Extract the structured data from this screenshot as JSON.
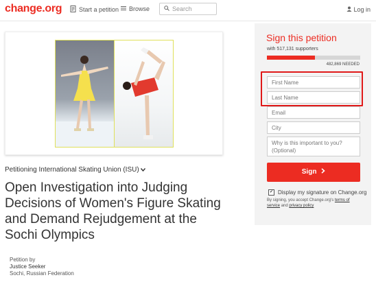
{
  "header": {
    "logo": "change.org",
    "start_petition": "Start a petition",
    "browse": "Browse",
    "search_placeholder": "Search",
    "login": "Log in"
  },
  "petition": {
    "petitioning": "Petitioning International Skating Union (ISU)",
    "title": "Open Investigation into Judging Decisions of Women's Figure Skating and Demand Rejudgement at the Sochi Olympics",
    "petition_by_label": "Petition by",
    "author": "Justice Seeker",
    "location": "Sochi, Russian Federation"
  },
  "sign_panel": {
    "heading": "Sign this petition",
    "supporters": "with 517,131 supporters",
    "progress": 0.516,
    "needed": "482,869 NEEDED",
    "fields": {
      "first_name": "First Name",
      "last_name": "Last Name",
      "email": "Email",
      "city": "City",
      "why": "Why is this important to you? (Optional)"
    },
    "sign_button": "Sign",
    "display_signature": "Display my signature on Change.org",
    "terms_prefix": "By signing, you accept Change.org's",
    "terms_link": "terms of service",
    "terms_and": "and",
    "privacy_link": "privacy policy"
  },
  "colors": {
    "brand": "#ec2c22",
    "highlight": "#e01818"
  }
}
